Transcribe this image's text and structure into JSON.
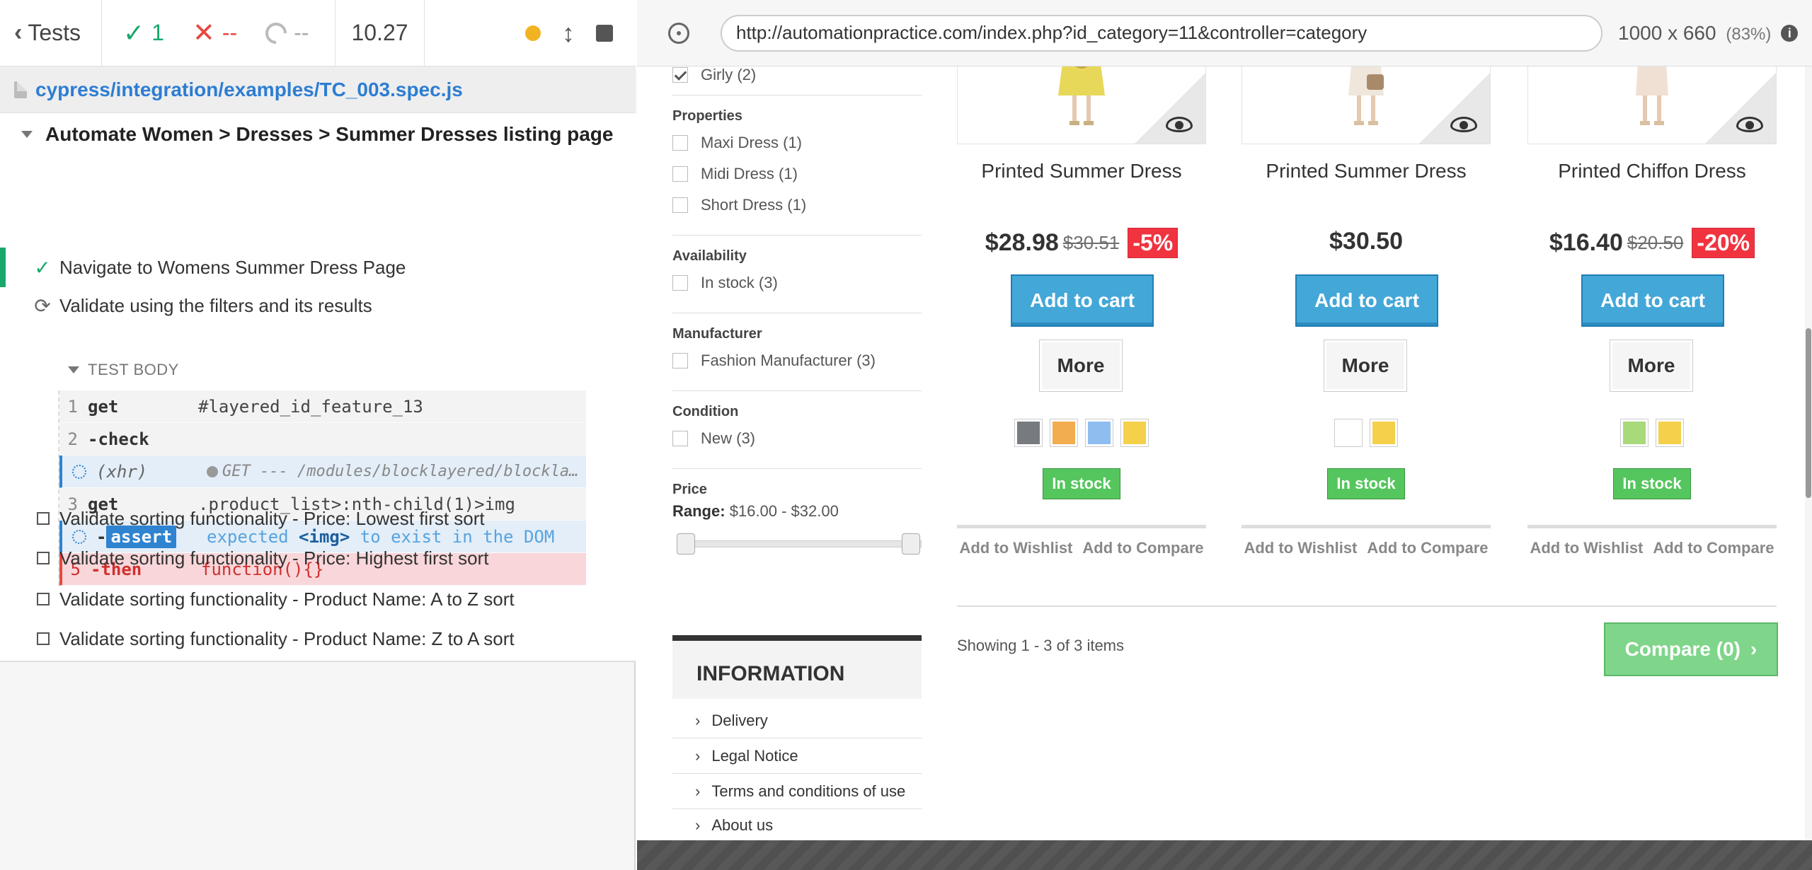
{
  "reporter": {
    "tests_label": "Tests",
    "passed": "1",
    "failed": "--",
    "pending": "--",
    "duration": "10.27",
    "spec_path": "cypress/integration/examples/TC_003.spec.js",
    "suite_title": "Automate Women > Dresses > Summer Dresses listing page",
    "tests": [
      {
        "title": "Navigate to Womens Summer Dress Page",
        "state": "passed"
      },
      {
        "title": "Validate using the filters and its results",
        "state": "running"
      }
    ],
    "test_body_label": "TEST BODY",
    "commands": [
      {
        "num": "1",
        "name": "get",
        "message": "#layered_id_feature_13"
      },
      {
        "num": "2",
        "name": "-check",
        "message": ""
      },
      {
        "num": "",
        "name": "(xhr)",
        "message": "GET --- /modules/blocklayered/blocklayered-ajax.php"
      },
      {
        "num": "3",
        "name": "get",
        "message": ".product_list>:nth-child(1)>img"
      },
      {
        "num": "",
        "name": "assert",
        "prefix": "-",
        "message_pre": "expected",
        "message_em": "<img>",
        "message_post": "to exist in the DOM"
      },
      {
        "num": "5",
        "name": "-then",
        "message": "function(){}"
      }
    ],
    "pending_tests": [
      "Validate sorting functionality - Price: Lowest first sort",
      "Validate sorting functionality - Price: Highest first sort",
      "Validate sorting functionality - Product Name: A to Z sort",
      "Validate sorting functionality - Product Name: Z to A sort"
    ]
  },
  "aut": {
    "url": "http://automationpractice.com/index.php?id_category=11&controller=category",
    "viewport": "1000 x 660",
    "zoom": "(83%)"
  },
  "filters": {
    "girly": "Girly (2)",
    "properties_title": "Properties",
    "properties": [
      "Maxi Dress (1)",
      "Midi Dress (1)",
      "Short Dress (1)"
    ],
    "availability_title": "Availability",
    "availability": "In stock (3)",
    "manufacturer_title": "Manufacturer",
    "manufacturer": "Fashion Manufacturer (3)",
    "condition_title": "Condition",
    "condition": "New (3)",
    "price_title": "Price",
    "range_label": "Range:",
    "range_value": "$16.00 - $32.00"
  },
  "information": {
    "title": "INFORMATION",
    "links": [
      "Delivery",
      "Legal Notice",
      "Terms and conditions of use",
      "About us"
    ]
  },
  "products": [
    {
      "name": "Printed Summer Dress",
      "price": "$28.98",
      "old_price": "$30.51",
      "reduction": "-5%",
      "add_to_cart": "Add to cart",
      "more": "More",
      "swatches": [
        "#777b80",
        "#f2ad4e",
        "#8fbdf0",
        "#f5d04a"
      ],
      "stock": "In stock",
      "wishlist": "Add to Wishlist",
      "compare": "Add to Compare"
    },
    {
      "name": "Printed Summer Dress",
      "price": "$30.50",
      "old_price": "",
      "reduction": "",
      "add_to_cart": "Add to cart",
      "more": "More",
      "swatches": [
        "#ffffff",
        "#f5d04a"
      ],
      "stock": "In stock",
      "wishlist": "Add to Wishlist",
      "compare": "Add to Compare"
    },
    {
      "name": "Printed Chiffon Dress",
      "price": "$16.40",
      "old_price": "$20.50",
      "reduction": "-20%",
      "add_to_cart": "Add to cart",
      "more": "More",
      "swatches": [
        "#a8d97a",
        "#f5d04a"
      ],
      "stock": "In stock",
      "wishlist": "Add to Wishlist",
      "compare": "Add to Compare"
    }
  ],
  "listing": {
    "showing": "Showing 1 - 3 of 3 items",
    "compare_button": "Compare (0)"
  }
}
